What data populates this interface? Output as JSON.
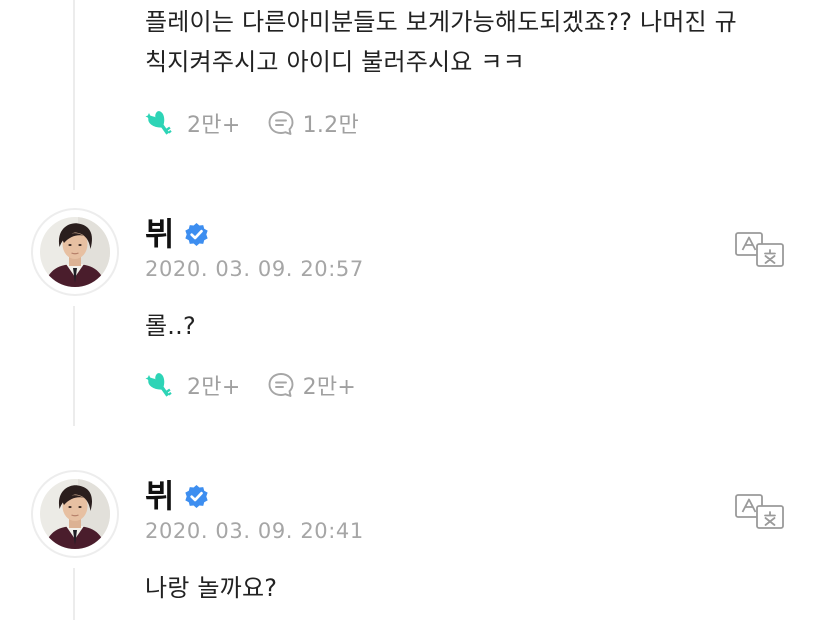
{
  "colors": {
    "accent": "#2dd4b6",
    "verified": "#3d8ef0",
    "muted": "#a6a6a6",
    "text": "#222222",
    "thread_line": "#ececec"
  },
  "comments": [
    {
      "text": "플레이는 다른아미분들도 보게가능해도되겠죠?? 나머진 규\n칙지켜주시고 아이디 불러주시요 ㅋㅋ",
      "likes": "2만+",
      "replies": "1.2만",
      "like_icon": "heart-key-icon",
      "reply_icon": "speech-bubble-icon"
    },
    {
      "author": "뷔",
      "avatar_icon": "profile-photo",
      "verified_icon": "verified-badge-icon",
      "timestamp": "2020. 03. 09. 20:57",
      "translate_icon": "translate-icon",
      "text": "롤..?",
      "likes": "2만+",
      "replies": "2만+"
    },
    {
      "author": "뷔",
      "avatar_icon": "profile-photo",
      "verified_icon": "verified-badge-icon",
      "timestamp": "2020. 03. 09. 20:41",
      "translate_icon": "translate-icon",
      "text": "나랑 놀까요?"
    }
  ]
}
